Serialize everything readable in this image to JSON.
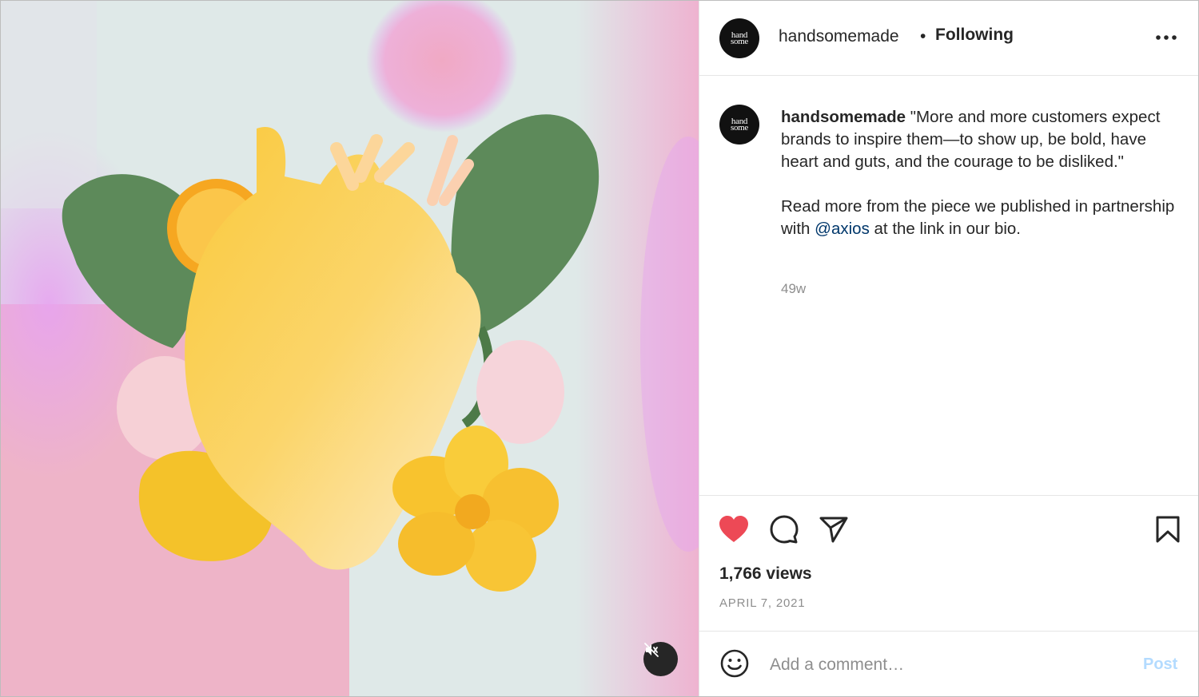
{
  "media": {
    "mute_icon": "speaker-muted-icon"
  },
  "header": {
    "avatar_text_line1": "hand",
    "avatar_text_line2": "some",
    "username": "handsomemade",
    "separator": "•",
    "follow_label": "Following",
    "more_icon": "more-horizontal-icon"
  },
  "caption": {
    "avatar_text_line1": "hand",
    "avatar_text_line2": "some",
    "username": "handsomemade",
    "text1": " \"More and more customers expect brands to inspire them—to show up, be bold, have heart and guts, and the courage to be disliked.\"",
    "text2_before": "Read more from the piece we published in partnership with ",
    "mention": "@axios",
    "text2_after": " at the link in our bio.",
    "time_ago": "49w"
  },
  "actions": {
    "like_icon": "heart-filled-icon",
    "comment_icon": "comment-bubble-icon",
    "share_icon": "paper-plane-icon",
    "save_icon": "bookmark-icon",
    "like_color": "#ed4956",
    "views": "1,766 views",
    "date": "APRIL 7, 2021"
  },
  "comment": {
    "emoji_icon": "smiley-icon",
    "placeholder": "Add a comment…",
    "post_label": "Post",
    "post_color": "#b3dbff"
  }
}
